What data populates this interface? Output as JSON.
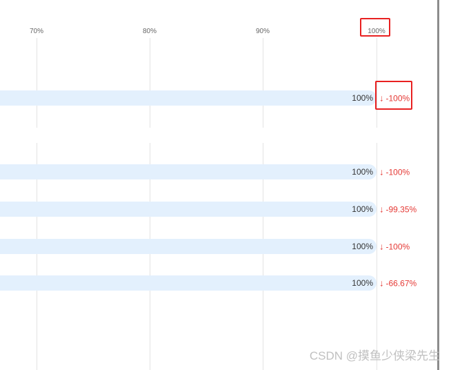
{
  "chart_data": {
    "type": "bar",
    "orientation": "horizontal",
    "x_ticks": [
      "70%",
      "80%",
      "90%",
      "100%"
    ],
    "xlim": [
      0,
      100
    ],
    "grid": true,
    "rows": [
      {
        "value": 100,
        "label": "100%",
        "change": "-100%",
        "direction": "down"
      },
      {
        "value": 100,
        "label": "100%",
        "change": "-100%",
        "direction": "down"
      },
      {
        "value": 100,
        "label": "100%",
        "change": "-99.35%",
        "direction": "down"
      },
      {
        "value": 100,
        "label": "100%",
        "change": "-100%",
        "direction": "down"
      },
      {
        "value": 100,
        "label": "100%",
        "change": "-66.67%",
        "direction": "down"
      }
    ]
  },
  "arrow_glyph": "↓",
  "watermark": "CSDN @摸鱼少侠梁先生",
  "colors": {
    "bar": "#e3f0fd",
    "negative": "#e53935",
    "highlight": "#e82020"
  }
}
